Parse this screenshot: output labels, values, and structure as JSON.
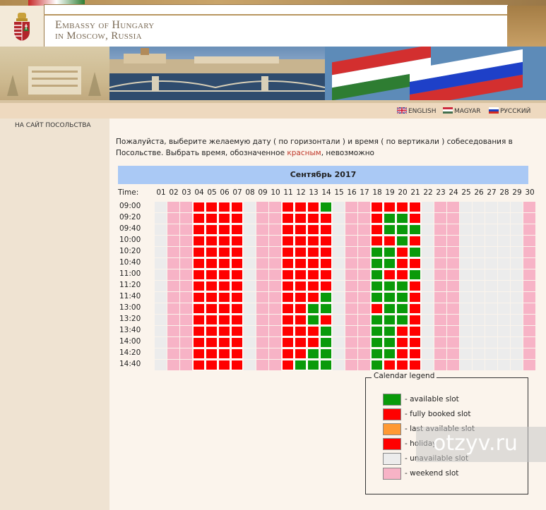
{
  "header": {
    "title_line1": "Embassy of Hungary",
    "title_line2": "in Moscow, Russia"
  },
  "languages": [
    {
      "label": "ENGLISH",
      "flag_icon": "uk-flag-icon"
    },
    {
      "label": "MAGYAR",
      "flag_icon": "hungary-flag-icon"
    },
    {
      "label": "РУССКИЙ",
      "flag_icon": "russia-flag-icon"
    }
  ],
  "sidebar": {
    "nav_label": "НА САЙТ ПОСОЛЬСТВА"
  },
  "instructions": {
    "part1": "Пожалуйста, выберите желаемую дату ( по горизонтали ) и время ( по вертикали ) собеседования в Посольстве. Выбрать время, обозначенное ",
    "highlight": "красным",
    "part2": ", невозможно"
  },
  "calendar": {
    "month_title": "Сентябрь 2017",
    "time_header": "Time:",
    "days": [
      "01",
      "02",
      "03",
      "04",
      "05",
      "06",
      "07",
      "08",
      "09",
      "10",
      "11",
      "12",
      "13",
      "14",
      "15",
      "16",
      "17",
      "18",
      "19",
      "20",
      "21",
      "22",
      "23",
      "24",
      "25",
      "26",
      "27",
      "28",
      "29",
      "30"
    ],
    "times": [
      "09:00",
      "09:20",
      "09:40",
      "10:00",
      "10:20",
      "10:40",
      "11:00",
      "11:20",
      "11:40",
      "13:00",
      "13:20",
      "13:40",
      "14:00",
      "14:20",
      "14:40"
    ],
    "status_colors": {
      "U": "#ececec",
      "W": "#f7b3c6",
      "R": "#ff0000",
      "G": "#0a9a0a",
      "L": "#ff9933"
    },
    "grid_by_day": [
      "UUUUUUUUUUUUUUU",
      "WWWWWWWWWWWWWWW",
      "WWWWWWWWWWWWWWW",
      "RRRRRRRRRRRRRRR",
      "RRRRRRRRRRRRRRR",
      "RRRRRRRRRRRRRRR",
      "RRRRRRRRRRRRRRR",
      "UUUUUUUUUUUUUUU",
      "WWWWWWWWWWWWWWW",
      "WWWWWWWWWWWWWWW",
      "RRRRRRRRRRRRRRR",
      "RRRRRRRRRRRRRRG",
      "RRRRRRRRRGGRRGG",
      "GRRRRRRRGGRGGGG",
      "UUUUUUUUUUUUUUU",
      "WWWWWWWWWWWWWWW",
      "WWWWWWWWWWWWWWW",
      "RRRRGGGGGRGGGGG",
      "RGGRGGRGGGGGGGR",
      "RGGGRRRGGGGRRRR",
      "RRGRGRGRRRRRRRR",
      "UUUUUUUUUUUUUUU",
      "WWWWWWWWWWWWWWW",
      "WWWWWWWWWWWWWWW",
      "UUUUUUUUUUUUUUU",
      "UUUUUUUUUUUUUUU",
      "UUUUUUUUUUUUUUU",
      "UUUUUUUUUUUUUUU",
      "UUUUUUUUUUUUUUU",
      "WWWWWWWWWWWWWWW"
    ]
  },
  "legend": {
    "title": "Calendar legend",
    "items": [
      {
        "label": "- available slot",
        "color": "#0a9a0a"
      },
      {
        "label": "- fully booked slot",
        "color": "#ff0000"
      },
      {
        "label": "- last available slot",
        "color": "#ff9933"
      },
      {
        "label": "- holiday",
        "color": "#ff0000"
      },
      {
        "label": "- unavailable slot",
        "color": "#ececec"
      },
      {
        "label": "- weekend slot",
        "color": "#f7b3c6"
      }
    ]
  },
  "watermark": {
    "text": "otzyv.ru"
  }
}
